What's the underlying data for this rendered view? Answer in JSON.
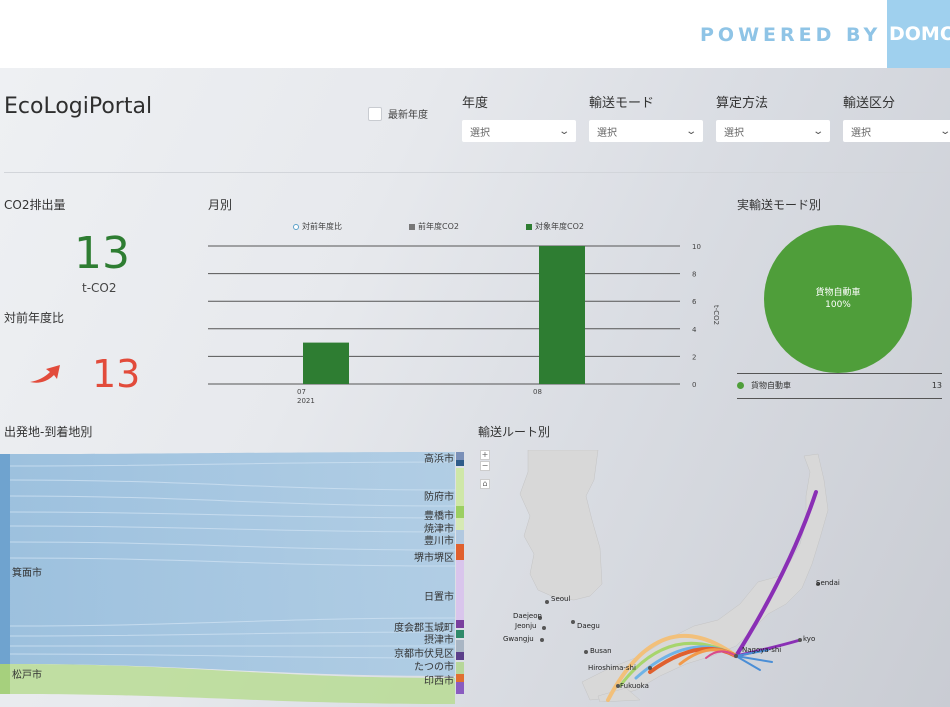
{
  "banner": {
    "powered_by": "POWERED BY",
    "logo_text": "DOMO"
  },
  "header": {
    "title": "EcoLogiPortal",
    "latest_year_label": "最新年度",
    "filters": [
      {
        "label": "年度",
        "value": "選択"
      },
      {
        "label": "輸送モード",
        "value": "選択"
      },
      {
        "label": "算定方法",
        "value": "選択"
      },
      {
        "label": "輸送区分",
        "value": "選択"
      }
    ]
  },
  "kpi": {
    "co2_title": "CO2排出量",
    "co2_value": "13",
    "co2_unit": "t-CO2",
    "yoy_title": "対前年度比",
    "yoy_arrow": "up-right-arrow-icon",
    "yoy_value": "13"
  },
  "monthly": {
    "title": "月別",
    "legend": [
      "対前年度比",
      "前年度CO2",
      "対象年度CO2"
    ],
    "y_axis_label": "t-CO2"
  },
  "chart_data": {
    "type": "bar",
    "categories": [
      "07\n2021",
      "08"
    ],
    "tick_top": [
      "07",
      "08"
    ],
    "tick_sub": [
      "2021",
      ""
    ],
    "series": [
      {
        "name": "対象年度CO2",
        "values": [
          3,
          10
        ]
      }
    ],
    "ylim": [
      0,
      10
    ],
    "yticks": [
      "0",
      "2",
      "4",
      "6",
      "8",
      "10"
    ],
    "grid": true,
    "colors": {
      "current": "#2e7d32",
      "prev": "#777777",
      "yoy": "#5aa0c8"
    }
  },
  "mode": {
    "title": "実輸送モード別",
    "slice_label": "貨物自動車",
    "slice_pct": "100%",
    "legend_label": "貨物自動車",
    "legend_value": "13",
    "color": "#4f9e3a"
  },
  "sankey": {
    "title": "出発地-到着地別",
    "sources": [
      "箕面市",
      "松戸市"
    ],
    "destinations": [
      "高浜市",
      "防府市",
      "豊橋市",
      "焼津市",
      "豊川市",
      "堺市堺区",
      "日置市",
      "度会郡玉城町",
      "摂津市",
      "京都市伏見区",
      "たつの市",
      "印西市"
    ]
  },
  "route_map": {
    "title": "輸送ルート別",
    "controls": [
      "+",
      "−",
      "⌂"
    ],
    "cities": [
      "Seoul",
      "Daejeon",
      "Jeonju",
      "Daegu",
      "Gwangju",
      "Busan",
      "Hiroshima-shi",
      "Fukuoka",
      "Sendai",
      "Nagoya-shi",
      "kyo"
    ]
  }
}
